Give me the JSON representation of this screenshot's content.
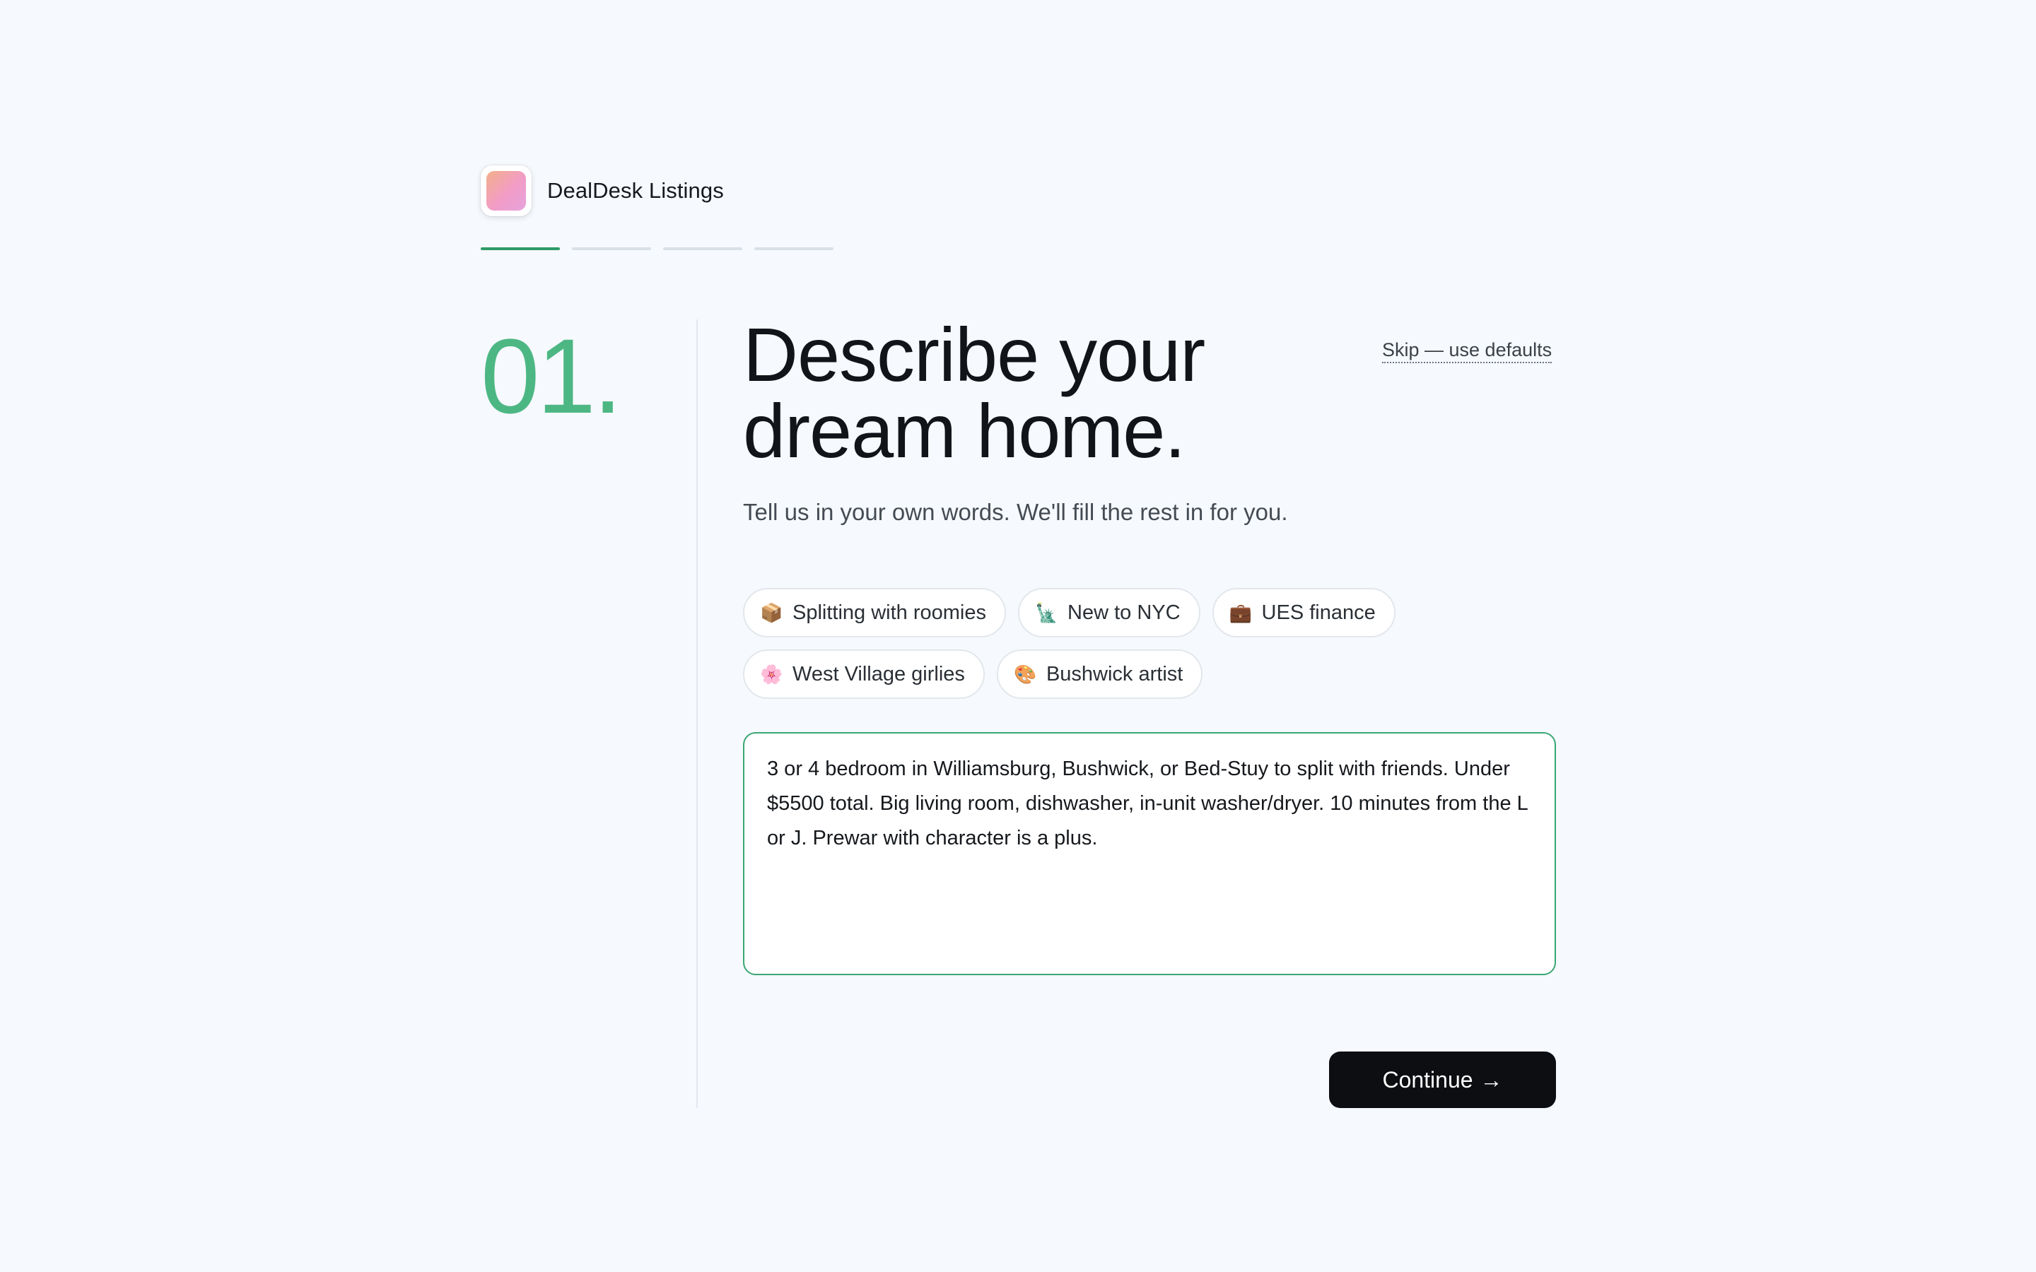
{
  "brand": {
    "name": "DealDesk Listings"
  },
  "progress": {
    "current_step": 1,
    "total_steps": 4
  },
  "step": {
    "number": "01.",
    "headline_line1": "Describe your",
    "headline_line2": "dream home.",
    "subtitle": "Tell us in your own words. We'll fill the rest in for you.",
    "skip_label": "Skip — use defaults"
  },
  "chips": [
    {
      "icon": "moving-box-icon",
      "glyph": "📦",
      "label": "Splitting with roomies"
    },
    {
      "icon": "statue-of-liberty-icon",
      "glyph": "🗽",
      "label": "New to NYC"
    },
    {
      "icon": "briefcase-icon",
      "glyph": "💼",
      "label": "UES finance"
    },
    {
      "icon": "cherry-blossom-icon",
      "glyph": "🌸",
      "label": "West Village girlies"
    },
    {
      "icon": "palette-icon",
      "glyph": "🎨",
      "label": "Bushwick artist"
    }
  ],
  "description": {
    "value": "3 or 4 bedroom in Williamsburg, Bushwick, or Bed-Stuy to split with friends. Under $5500 total. Big living room, dishwasher, in-unit washer/dryer. 10 minutes from the L or J. Prewar with character is a plus."
  },
  "actions": {
    "continue_label": "Continue",
    "continue_arrow": "→"
  },
  "colors": {
    "accent": "#4db784",
    "accent_dark": "#2f9a67",
    "background": "#f6f9fd",
    "button": "#0c0e11"
  }
}
